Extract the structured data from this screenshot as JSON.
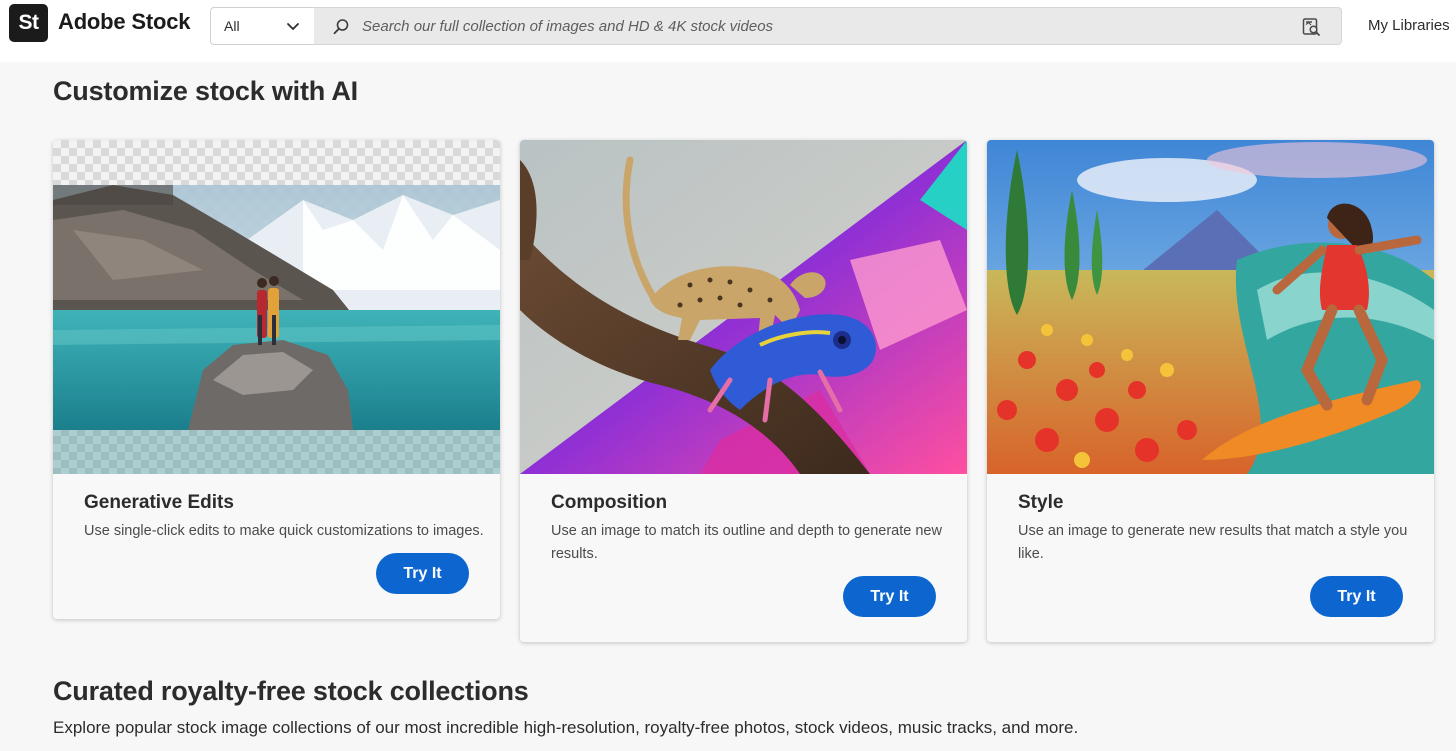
{
  "header": {
    "logo_mark": "St",
    "logo_text": "Adobe Stock",
    "scope": "All",
    "search_placeholder": "Search our full collection of images and HD & 4K stock videos",
    "my_libraries": "My Libraries"
  },
  "ai_section": {
    "title": "Customize stock with AI",
    "cards": [
      {
        "title": "Generative Edits",
        "description": "Use single-click edits to make quick customizations to images.",
        "button": "Try It"
      },
      {
        "title": "Composition",
        "description": "Use an image to match its outline and depth to generate new results.",
        "button": "Try It"
      },
      {
        "title": "Style",
        "description": "Use an image to generate new results that match a style you like.",
        "button": "Try It"
      }
    ]
  },
  "collections_section": {
    "title": "Curated royalty-free stock collections",
    "description": "Explore popular stock image collections of our most incredible high-resolution, royalty-free photos, stock videos, music tracks, and more."
  },
  "icons": {
    "scope_chevron": "chevron-down-icon",
    "search": "search-icon",
    "visual_search": "visual-search-icon"
  },
  "colors": {
    "accent": "#0d66d0",
    "logo_bg": "#1b1b1b",
    "page_bg": "#f7f7f7"
  }
}
